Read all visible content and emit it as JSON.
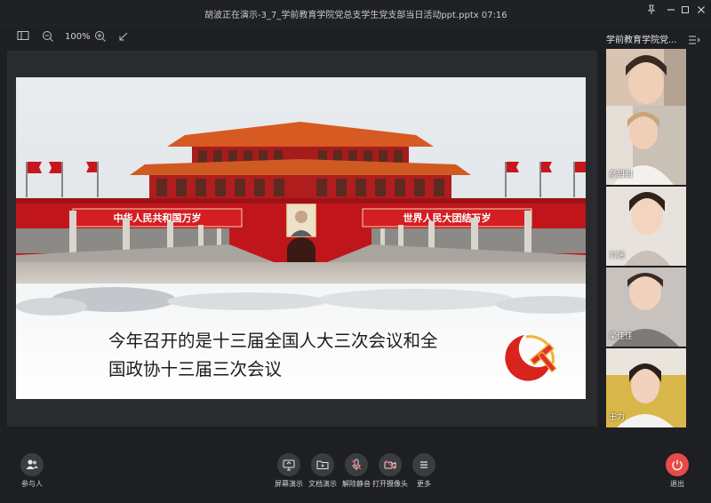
{
  "window": {
    "title": "胡波正在演示-3_7_学前教育学院党总支学生党支部当日活动ppt.pptx 07:16"
  },
  "toolbar": {
    "zoom": "100%"
  },
  "slide": {
    "banner_left": "中华人民共和国万岁",
    "banner_right": "世界人民大团结万岁",
    "caption_line1": "今年召开的是十三届全国人大三次会议和全",
    "caption_line2": "国政协十三届三次会议"
  },
  "panel": {
    "title": "学前教育学院党..."
  },
  "participants": [
    {
      "name": "李欣"
    },
    {
      "name": "彦甜甜"
    },
    {
      "name": "刘涵"
    },
    {
      "name": "梁佳佳"
    },
    {
      "name": "王力"
    }
  ],
  "controls": {
    "participants_label": "参与人",
    "screen_share_label": "屏幕演示",
    "doc_share_label": "文档演示",
    "unmute_label": "解除静音",
    "camera_label": "打开摄像头",
    "more_label": "更多",
    "exit_label": "退出"
  },
  "colors": {
    "accent_red": "#e84a4a",
    "slide_red": "#c0161b",
    "roof_orange": "#d65a22"
  }
}
